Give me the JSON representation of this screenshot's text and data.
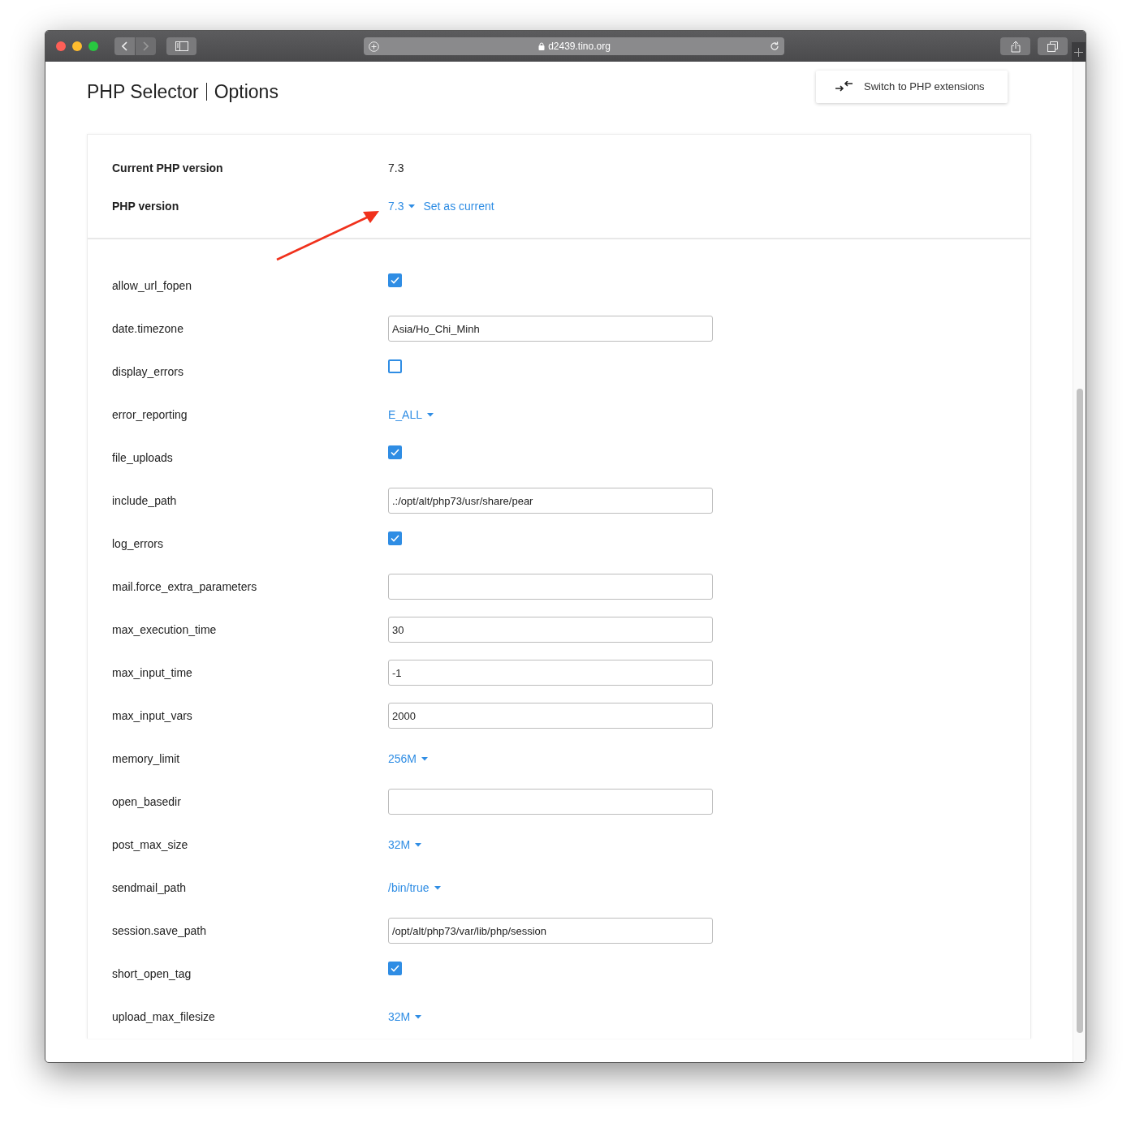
{
  "browser": {
    "url": "d2439.tino.org"
  },
  "header": {
    "title": "PHP Selector",
    "subtitle": "Options",
    "switch_button": "Switch to PHP extensions"
  },
  "version": {
    "current_label": "Current PHP version",
    "current_value": "7.3",
    "select_label": "PHP version",
    "select_value": "7.3",
    "set_current": "Set as current"
  },
  "options": [
    {
      "name": "allow_url_fopen",
      "kind": "checkbox",
      "checked": true
    },
    {
      "name": "date.timezone",
      "kind": "text",
      "value": "Asia/Ho_Chi_Minh"
    },
    {
      "name": "display_errors",
      "kind": "checkbox",
      "checked": false
    },
    {
      "name": "error_reporting",
      "kind": "dropdown",
      "value": "E_ALL"
    },
    {
      "name": "file_uploads",
      "kind": "checkbox",
      "checked": true
    },
    {
      "name": "include_path",
      "kind": "text",
      "value": ".:/opt/alt/php73/usr/share/pear"
    },
    {
      "name": "log_errors",
      "kind": "checkbox",
      "checked": true
    },
    {
      "name": "mail.force_extra_parameters",
      "kind": "text"
    },
    {
      "name": "max_execution_time",
      "kind": "text",
      "value": "30"
    },
    {
      "name": "max_input_time",
      "kind": "text",
      "value": "-1"
    },
    {
      "name": "max_input_vars",
      "kind": "text",
      "value": "2000"
    },
    {
      "name": "memory_limit",
      "kind": "dropdown",
      "value": "256M"
    },
    {
      "name": "open_basedir",
      "kind": "text"
    },
    {
      "name": "post_max_size",
      "kind": "dropdown",
      "value": "32M"
    },
    {
      "name": "sendmail_path",
      "kind": "dropdown",
      "value": "/bin/true"
    },
    {
      "name": "session.save_path",
      "kind": "text",
      "value": "/opt/alt/php73/var/lib/php/session"
    },
    {
      "name": "short_open_tag",
      "kind": "checkbox",
      "checked": true
    },
    {
      "name": "upload_max_filesize",
      "kind": "dropdown",
      "value": "32M"
    }
  ]
}
